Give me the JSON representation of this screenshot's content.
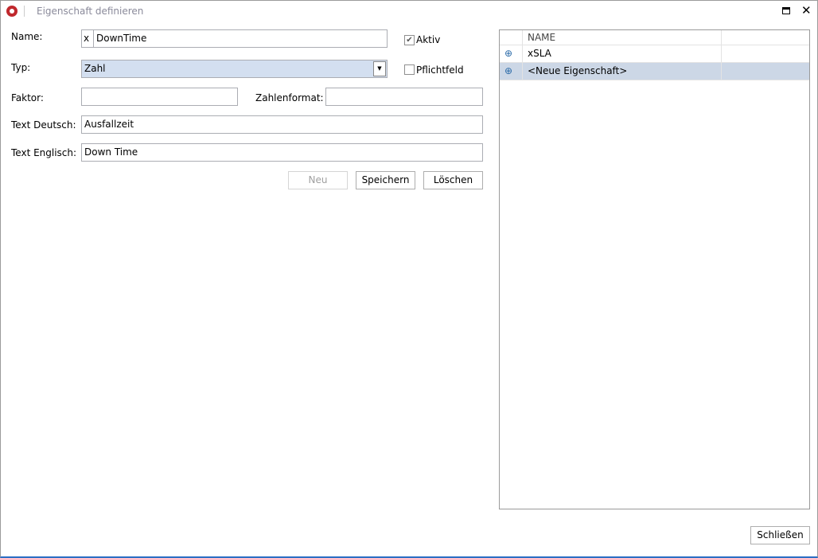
{
  "window": {
    "title": "Eigenschaft definieren"
  },
  "form": {
    "name_label": "Name:",
    "name_prefix": "x",
    "name_value": "DownTime",
    "aktiv_label": "Aktiv",
    "aktiv_checked": true,
    "typ_label": "Typ:",
    "typ_value": "Zahl",
    "pflicht_label": "Pflichtfeld",
    "pflicht_checked": false,
    "faktor_label": "Faktor:",
    "faktor_value": "",
    "zahlenformat_label": "Zahlenformat:",
    "zahlenformat_value": "",
    "text_de_label": "Text Deutsch:",
    "text_de_value": "Ausfallzeit",
    "text_en_label": "Text Englisch:",
    "text_en_value": "Down Time",
    "neu": "Neu",
    "speichern": "Speichern",
    "loeschen": "Löschen"
  },
  "grid": {
    "header": "NAME",
    "rows": [
      {
        "name": "xSLA",
        "selected": false
      },
      {
        "name": "<Neue Eigenschaft>",
        "selected": true
      }
    ]
  },
  "footer": {
    "close": "Schließen"
  },
  "colors": {
    "selection": "#ccd7e6",
    "accent": "#2b6fc4"
  }
}
